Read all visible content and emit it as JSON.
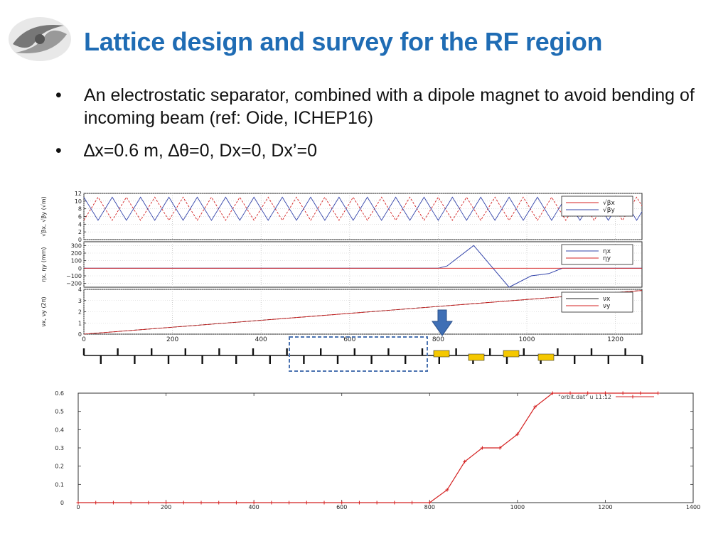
{
  "slide": {
    "title": "Lattice design and survey for the RF region",
    "bullets": [
      "An electrostatic separator, combined with a dipole magnet to avoid bending of incoming beam (ref: Oide, ICHEP16)",
      "∆x=0.6 m, ∆θ=0, Dx=0, Dx’=0"
    ],
    "bullet_symbol": "•"
  },
  "colors": {
    "title": "#1f6cb4",
    "series_x": "#d42020",
    "series_y": "#3344aa",
    "arrow": "#3f6fb5",
    "dashed_box": "#4a72b0",
    "magnet": "#f5c800"
  },
  "chart_data": [
    {
      "type": "line",
      "ylabel": "√βx, √βy (√m)",
      "ylim": [
        0,
        12
      ],
      "yticks": [
        "12",
        "10",
        "8",
        "6",
        "4",
        "2",
        "0"
      ],
      "legend": [
        "√βx",
        "√βy"
      ],
      "legend_position": "top-right",
      "grid": true,
      "series": [
        {
          "name": "√βx",
          "period": 64,
          "min": 5,
          "max": 11,
          "phase": 0
        },
        {
          "name": "√βy",
          "period": 64,
          "min": 5,
          "max": 11,
          "phase": 32
        }
      ]
    },
    {
      "type": "line",
      "ylabel": "ηx, ηy (mm)",
      "ylim": [
        -250,
        350
      ],
      "yticks": [
        "300",
        "200",
        "100",
        "0",
        "−100",
        "−200"
      ],
      "legend": [
        "ηx",
        "ηy"
      ],
      "legend_position": "top-right",
      "grid": true,
      "series": [
        {
          "name": "ηx",
          "x": [
            0,
            800,
            820,
            880,
            960,
            1010,
            1050,
            1080,
            1260
          ],
          "y": [
            0,
            0,
            30,
            300,
            -250,
            -100,
            -70,
            0,
            0
          ]
        },
        {
          "name": "ηy",
          "x": [
            0,
            1260
          ],
          "y": [
            0,
            0
          ]
        }
      ]
    },
    {
      "type": "line",
      "ylabel": "νx, νy (2π)",
      "ylim": [
        0,
        4
      ],
      "yticks": [
        "4",
        "3",
        "2",
        "1",
        "0"
      ],
      "legend": [
        "νx",
        "νy"
      ],
      "legend_position": "top-right",
      "grid": true,
      "xlim": [
        0,
        1260
      ],
      "xticks": [
        "0",
        "200",
        "400",
        "600",
        "800",
        "1000",
        "1200"
      ],
      "series": [
        {
          "name": "νx",
          "x": [
            0,
            1260
          ],
          "y": [
            0,
            3.9
          ]
        },
        {
          "name": "νy",
          "x": [
            0,
            1260
          ],
          "y": [
            0,
            3.9
          ]
        }
      ]
    },
    {
      "type": "line",
      "legend": [
        "\"orbit.dat\" u 11:12"
      ],
      "legend_position": "top-right",
      "xlim": [
        0,
        1400
      ],
      "ylim": [
        0,
        0.6
      ],
      "xticks": [
        "0",
        "200",
        "400",
        "600",
        "800",
        "1000",
        "1200",
        "1400"
      ],
      "yticks": [
        "0.6",
        "0.5",
        "0.4",
        "0.3",
        "0.2",
        "0.1",
        "0"
      ],
      "series": [
        {
          "name": "\"orbit.dat\" u 11:12",
          "x": [
            0,
            40,
            80,
            120,
            160,
            200,
            240,
            280,
            320,
            360,
            400,
            440,
            480,
            520,
            560,
            600,
            640,
            680,
            720,
            760,
            800,
            840,
            880,
            920,
            960,
            1000,
            1040,
            1080,
            1120,
            1160,
            1200,
            1240,
            1280,
            1320
          ],
          "y": [
            0,
            0,
            0,
            0,
            0,
            0,
            0,
            0,
            0,
            0,
            0,
            0,
            0,
            0,
            0,
            0,
            0,
            0,
            0,
            0,
            0,
            0.07,
            0.225,
            0.3,
            0.3,
            0.375,
            0.525,
            0.6,
            0.6,
            0.6,
            0.6,
            0.6,
            0.6,
            0.6
          ]
        }
      ]
    }
  ]
}
